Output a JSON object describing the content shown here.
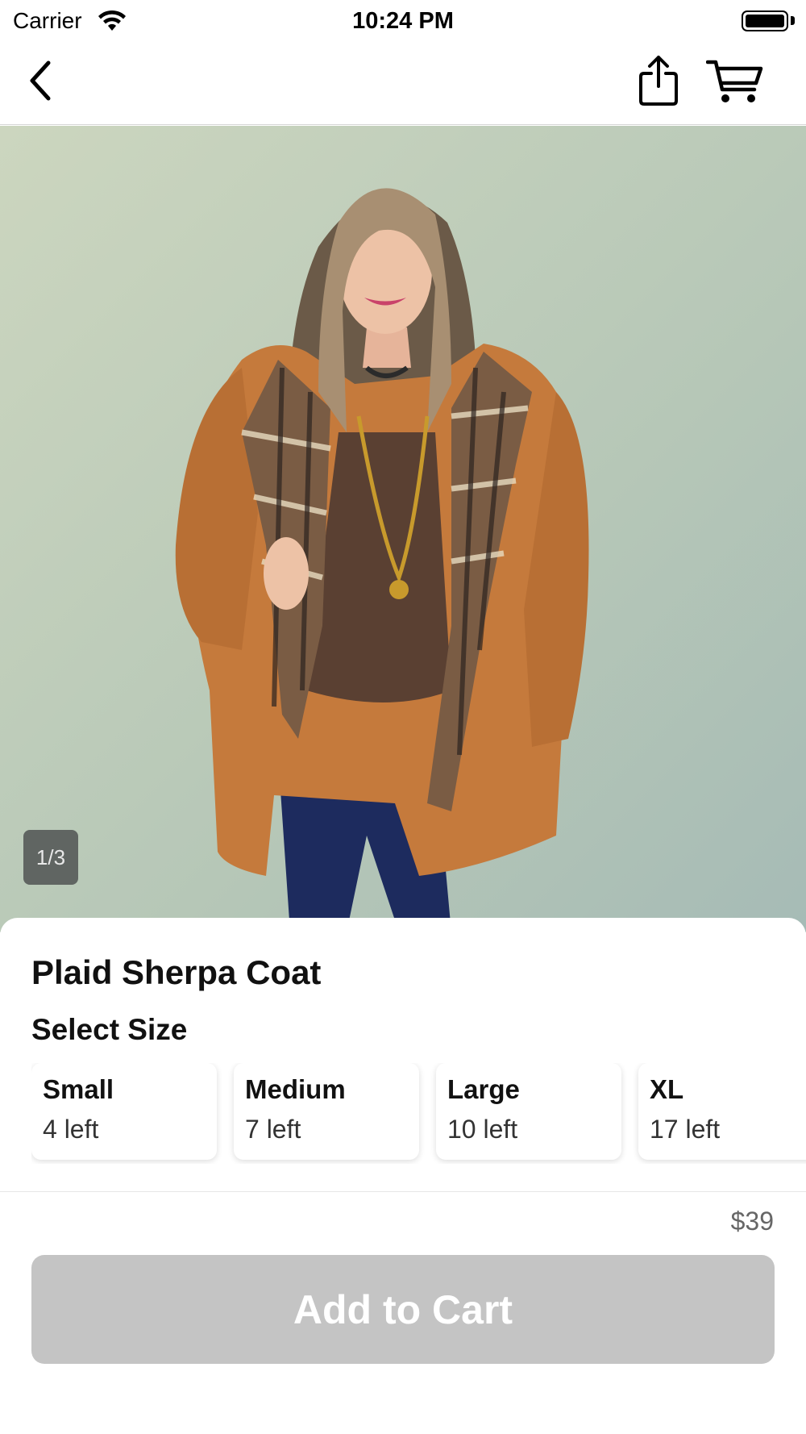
{
  "status_bar": {
    "carrier": "Carrier",
    "time": "10:24 PM",
    "wifi_icon": "wifi-icon",
    "battery_icon": "battery-icon"
  },
  "nav": {
    "back_icon": "chevron-left-icon",
    "share_icon": "share-icon",
    "cart_icon": "cart-icon"
  },
  "gallery": {
    "page_indicator": "1/3",
    "image_description_icon": "product-photo"
  },
  "product": {
    "title": "Plaid Sherpa Coat",
    "select_size_label": "Select Size",
    "sizes": [
      {
        "name": "Small",
        "stock": "4 left"
      },
      {
        "name": "Medium",
        "stock": "7 left"
      },
      {
        "name": "Large",
        "stock": "10 left"
      },
      {
        "name": "XL",
        "stock": "17 left"
      }
    ]
  },
  "footer": {
    "price": "$39",
    "add_to_cart_label": "Add to Cart"
  },
  "colors": {
    "disabled_button": "#c4c4c4",
    "background": "#ffffff",
    "text": "#111111"
  }
}
